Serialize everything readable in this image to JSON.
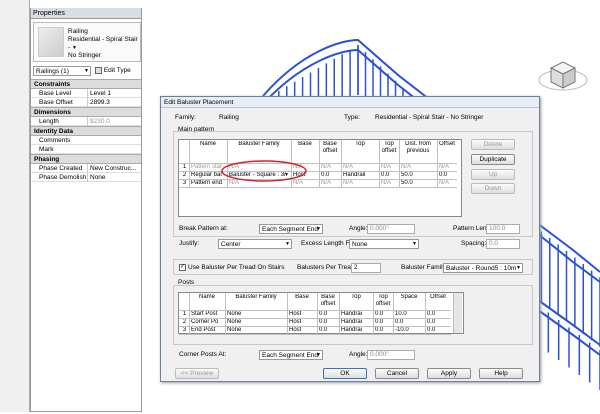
{
  "palette": {
    "title": "Properties"
  },
  "type_selector": {
    "line1": "Railing",
    "line2": "Residential - Spiral Stair -",
    "line3": "No Stringer"
  },
  "instance_select": {
    "value": "Railings (1)",
    "edit_type": "Edit Type"
  },
  "props": [
    {
      "group": "Constraints",
      "rows": [
        [
          "Base Level",
          "Level 1"
        ],
        [
          "Base Offset",
          "2899.3"
        ]
      ]
    },
    {
      "group": "Dimensions",
      "rows": [
        [
          "Length",
          "$230.0"
        ]
      ]
    },
    {
      "group": "Identity Data",
      "rows": [
        [
          "Comments",
          ""
        ],
        [
          "Mark",
          ""
        ]
      ]
    },
    {
      "group": "Phasing",
      "rows": [
        [
          "Phase Created",
          "New Construc..."
        ],
        [
          "Phase Demolish...",
          "None"
        ]
      ]
    }
  ],
  "dialog": {
    "title": "Edit Baluster Placement",
    "family_label": "Family:",
    "family_value": "Railing",
    "type_label": "Type:",
    "type_value": "Residential - Spiral Stair - No Stringer",
    "main_pattern": "Main pattern",
    "main_cols": [
      "Name",
      "Baluster Family",
      "Base",
      "Base offset",
      "Top",
      "Top offset",
      "Dist. from previous",
      "Offset"
    ],
    "main_rows": [
      [
        "1",
        "Pattern star",
        "N/A",
        "N/A",
        "N/A",
        "N/A",
        "N/A",
        "N/A",
        "N/A"
      ],
      [
        "2",
        "Regular bal",
        "Baluster - Square : 3/",
        "Host",
        "0.0",
        "Handrail",
        "0.0",
        "50.0",
        "0.0"
      ],
      [
        "3",
        "Pattern end",
        "N/A",
        "N/A",
        "N/A",
        "N/A",
        "N/A",
        "50.0",
        "N/A"
      ]
    ],
    "side_buttons": [
      "Delete",
      "Duplicate",
      "Up",
      "Down"
    ],
    "break_label": "Break Pattern at:",
    "break_value": "Each Segment End",
    "angle_label": "Angle:",
    "angle_value": "0.000°",
    "pattern_length_label": "Pattern Length:",
    "pattern_length_value": "100.0",
    "justify_label": "Justify:",
    "justify_value": "Center",
    "excess_label": "Excess Length Fill:",
    "excess_value": "None",
    "spacing_label": "Spacing:",
    "spacing_value": "0.0",
    "use_baluster_label": "Use Baluster Per Tread On Stairs",
    "use_baluster_checked": "✓",
    "per_tread_label": "Balusters Per Tread:",
    "per_tread_value": "2",
    "bfam_label": "Baluster Family:",
    "bfam_value": "Baluster - Round5 : 10m",
    "posts_label": "Posts",
    "post_cols": [
      "Name",
      "Baluster Family",
      "Base",
      "Base offset",
      "Top",
      "Top offset",
      "Space",
      "Offset"
    ],
    "post_rows": [
      [
        "1",
        "Start Post",
        "None",
        "Host",
        "0.0",
        "Handrai",
        "0.0",
        "10.0",
        "0.0"
      ],
      [
        "2",
        "Corner Po",
        "None",
        "Host",
        "0.0",
        "Handrai",
        "0.0",
        "0.0",
        "0.0"
      ],
      [
        "3",
        "End Post",
        "None",
        "Host",
        "0.0",
        "Handrai",
        "0.0",
        "-10.0",
        "0.0"
      ]
    ],
    "corner_label": "Corner Posts At:",
    "corner_value": "Each Segment End",
    "angle2_label": "Angle:",
    "angle2_value": "0.000°",
    "buttons": {
      "preview": "<< Preview",
      "ok": "OK",
      "cancel": "Cancel",
      "apply": "Apply",
      "help": "Help"
    }
  },
  "colors": {
    "railing": "#2a52d6",
    "highlight": "#d6202a"
  }
}
